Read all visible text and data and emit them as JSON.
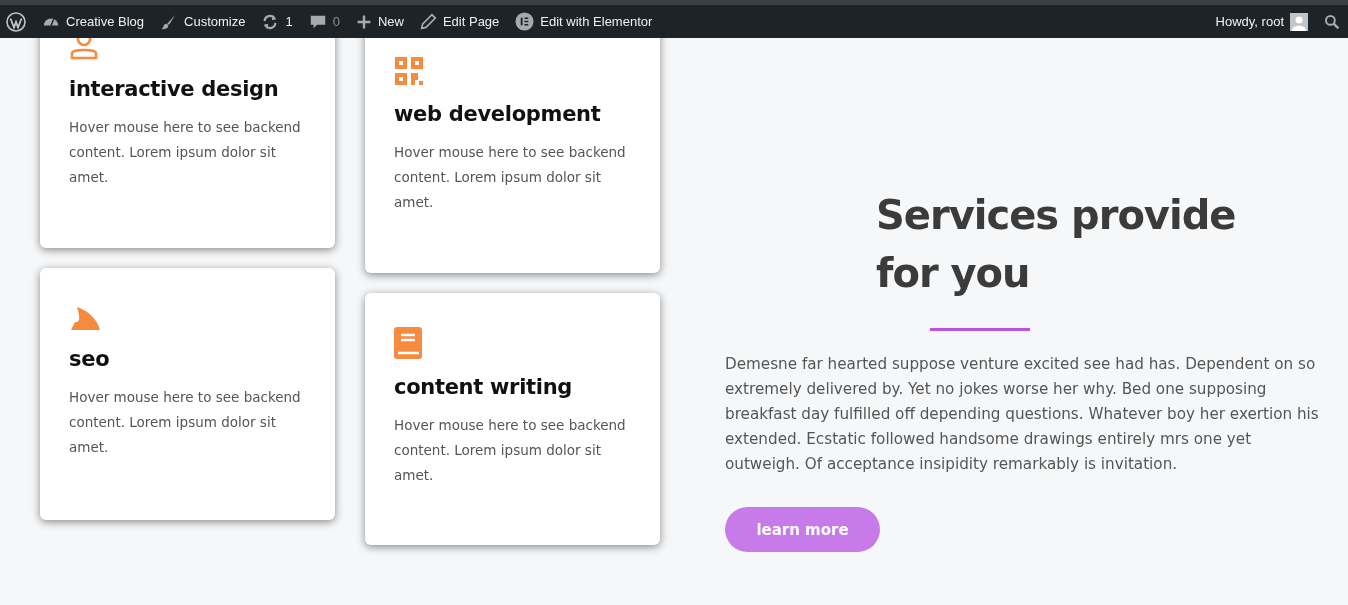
{
  "admin_bar": {
    "left": [
      {
        "kind": "wp"
      },
      {
        "kind": "dashboard",
        "label": "Creative Blog"
      },
      {
        "kind": "brush",
        "label": "Customize"
      },
      {
        "kind": "updates",
        "label": "1"
      },
      {
        "kind": "comments",
        "label": "0"
      },
      {
        "kind": "plus",
        "label": "New"
      },
      {
        "kind": "pencil",
        "label": "Edit Page"
      },
      {
        "kind": "elementor",
        "label": "Edit with Elementor"
      }
    ],
    "greeting": "Howdy, root"
  },
  "columns": [
    [
      {
        "kind": "person",
        "title": "interactive design",
        "text": "Hover mouse here to see backend content. Lorem ipsum dolor sit amet."
      },
      {
        "kind": "fin",
        "title": "seo",
        "text": "Hover mouse here to see backend content. Lorem ipsum dolor sit amet."
      }
    ],
    [
      {
        "kind": "qr",
        "title": "web development",
        "text": "Hover mouse here to see backend content. Lorem ipsum dolor sit amet."
      },
      {
        "kind": "book",
        "title": "content writing",
        "text": "Hover mouse here to see backend content. Lorem ipsum dolor sit amet."
      }
    ]
  ],
  "intro": {
    "heading": "Services provide for you",
    "text": "Demesne far hearted suppose venture excited see had has. Dependent on so extremely delivered by. Yet no jokes worse her why. Bed one supposing breakfast day fulfilled off depending questions. Whatever boy her exertion his extended. Ecstatic followed handsome drawings entirely mrs one yet outweigh. Of acceptance insipidity remarkably is invitation.",
    "button": "learn more"
  }
}
